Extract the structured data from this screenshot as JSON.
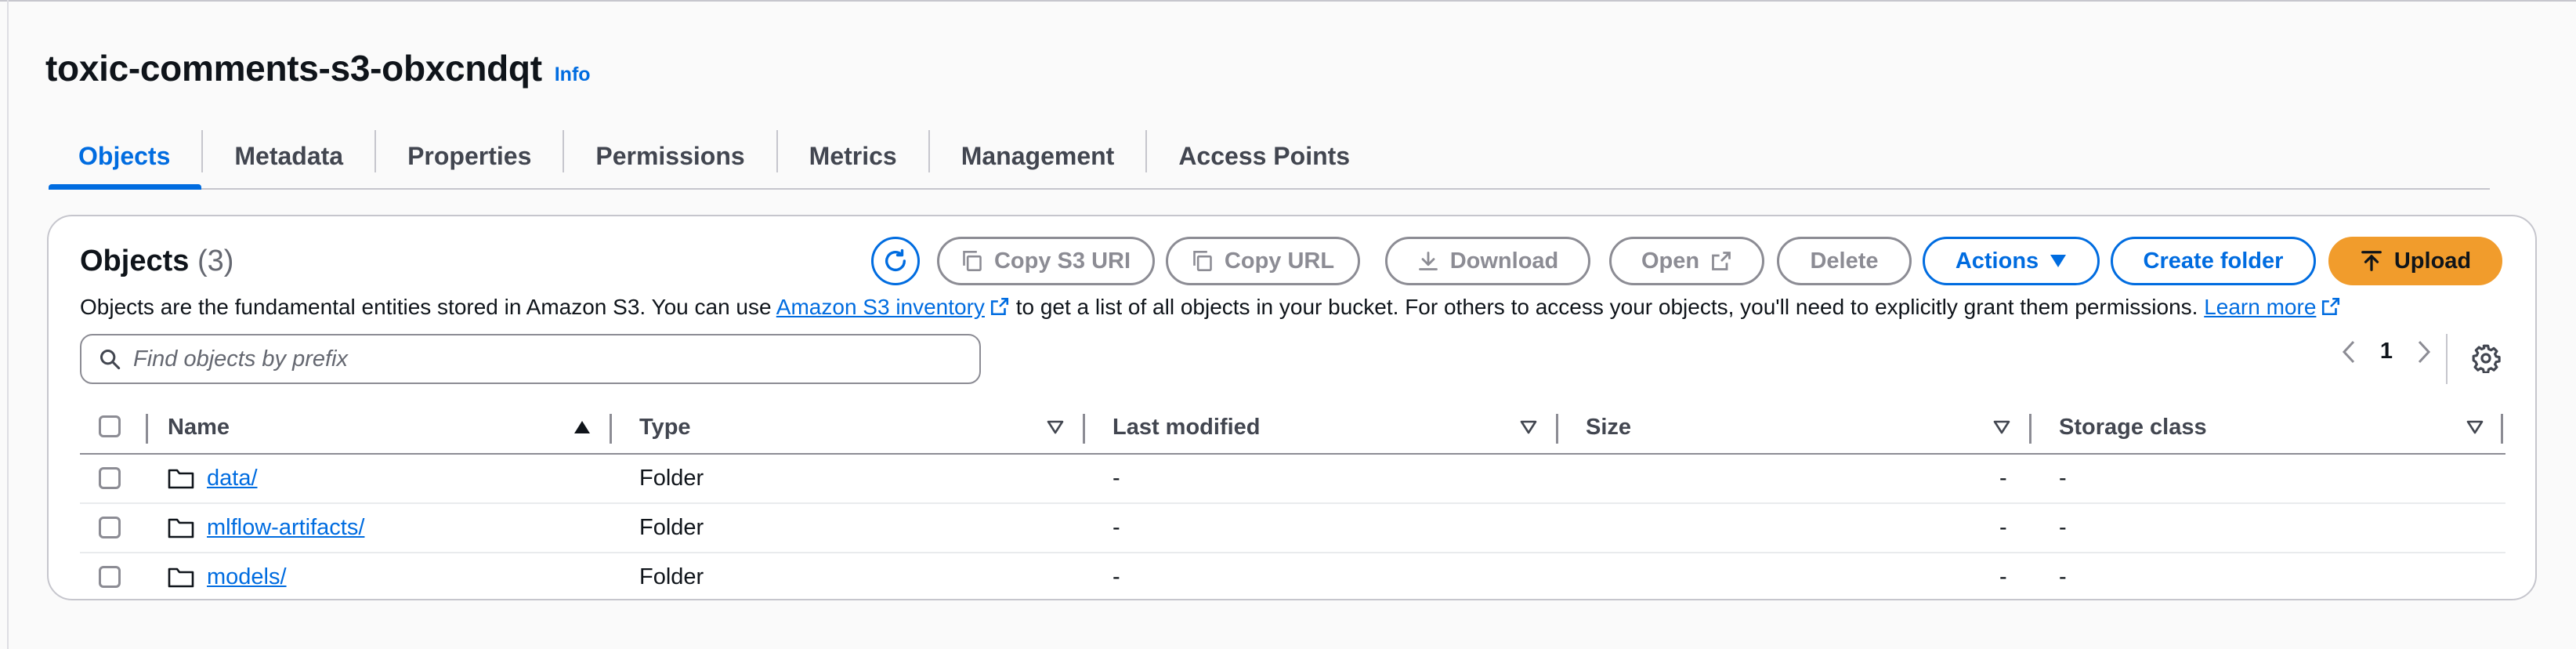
{
  "bucket": {
    "name": "toxic-comments-s3-obxcndqt",
    "info_label": "Info"
  },
  "tabs": [
    {
      "label": "Objects",
      "active": true
    },
    {
      "label": "Metadata"
    },
    {
      "label": "Properties"
    },
    {
      "label": "Permissions"
    },
    {
      "label": "Metrics"
    },
    {
      "label": "Management"
    },
    {
      "label": "Access Points"
    }
  ],
  "objects_panel": {
    "heading": "Objects",
    "count": "(3)",
    "description_before": "Objects are the fundamental entities stored in Amazon S3. You can use ",
    "inventory_link": "Amazon S3 inventory",
    "description_middle": " to get a list of all objects in your bucket. For others to access your objects, you'll need to explicitly grant them permissions. ",
    "learn_more": "Learn more",
    "search_placeholder": "Find objects by prefix",
    "search_value": "",
    "page_number": "1"
  },
  "toolbar": {
    "copy_s3_uri": "Copy S3 URI",
    "copy_url": "Copy URL",
    "download": "Download",
    "open": "Open",
    "delete": "Delete",
    "actions": "Actions",
    "create_folder": "Create folder",
    "upload": "Upload"
  },
  "table": {
    "headers": {
      "name": "Name",
      "type": "Type",
      "last_modified": "Last modified",
      "size": "Size",
      "storage_class": "Storage class"
    },
    "rows": [
      {
        "name": "data/",
        "type": "Folder",
        "last_modified": "-",
        "size": "-",
        "storage_class": "-"
      },
      {
        "name": "mlflow-artifacts/",
        "type": "Folder",
        "last_modified": "-",
        "size": "-",
        "storage_class": "-"
      },
      {
        "name": "models/",
        "type": "Folder",
        "last_modified": "-",
        "size": "-",
        "storage_class": "-"
      }
    ]
  },
  "colors": {
    "accent": "#006ce0",
    "upload": "#f19c2c",
    "disabled": "#8c8c94"
  },
  "icons": [
    "refresh-icon",
    "copy-icon",
    "download-icon",
    "external-link-icon",
    "caret-down-icon",
    "upload-icon",
    "search-icon",
    "chevron-left-icon",
    "chevron-right-icon",
    "settings-gear-icon",
    "folder-icon",
    "sort-ascending-icon",
    "sort-descending-icon"
  ]
}
